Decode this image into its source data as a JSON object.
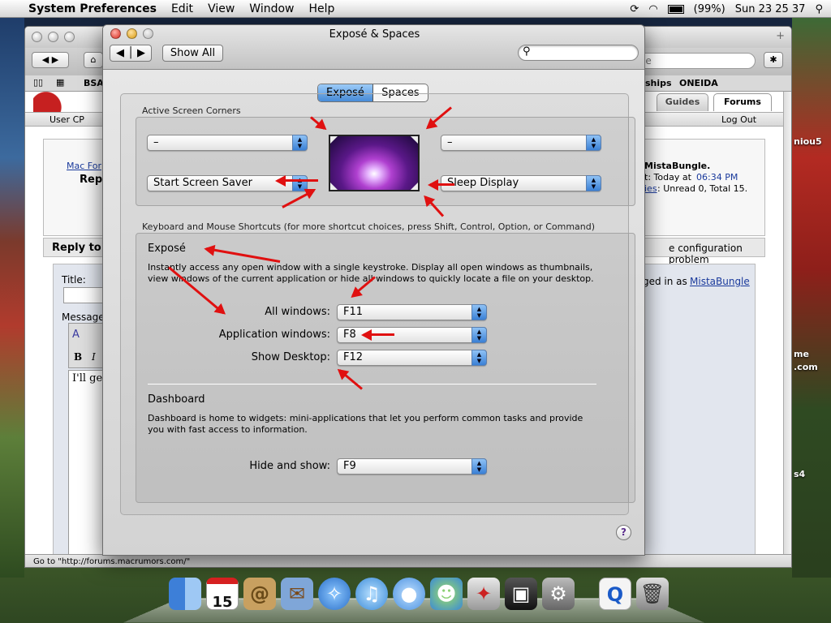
{
  "menubar": {
    "app": "System Preferences",
    "items": [
      "Edit",
      "View",
      "Window",
      "Help"
    ],
    "battery": "(99%)",
    "clock": "Sun 23 25 37"
  },
  "browser": {
    "bookmarks": [
      "BSAA",
      "ships",
      "ONEIDA"
    ],
    "url_tail": "le",
    "tabs": [
      "Guides",
      "Forums"
    ],
    "subnav": {
      "user_cp": "User CP",
      "log_out": "Log Out"
    },
    "breadcrumb": {
      "link": "Mac For",
      "current": "Rep"
    },
    "user_box": {
      "name": "MistaBungle.",
      "last_label": "t: Today at",
      "time": "06:34 PM",
      "pm_link": "ies",
      "pm_counts": ": Unread 0, Total 15."
    },
    "reply_heading": "Reply to",
    "thread_title_tail": "e configuration problem",
    "logged_in_prefix": "ged in as",
    "logged_in_user": "MistaBungle",
    "title_label": "Title:",
    "message_label": "Message:",
    "editor_text": "I'll ge",
    "status_text": "Go to \"http://forums.macrumors.com/\"",
    "right_edge_texts": {
      "user": "niou5",
      "me": "me",
      "com": ".com",
      "s4": "s4"
    }
  },
  "prefs": {
    "title": "Exposé & Spaces",
    "show_all": "Show All",
    "search_placeholder": "",
    "tabs": [
      "Exposé",
      "Spaces"
    ],
    "active_tab": "Exposé",
    "corners_title": "Active Screen Corners",
    "corners": {
      "top_left": "–",
      "top_right": "–",
      "bottom_left": "Start Screen Saver",
      "bottom_right": "Sleep Display"
    },
    "shortcuts_title": "Keyboard and Mouse Shortcuts (for more shortcut choices, press Shift, Control, Option, or Command)",
    "expose": {
      "heading": "Exposé",
      "desc1": "Instantly access any open window with a single keystroke. Display all open windows as thumbnails,",
      "desc2": "view windows of the current application or hide all windows to quickly locate a file on your desktop.",
      "rows": [
        {
          "label": "All windows:",
          "value": "F11"
        },
        {
          "label": "Application windows:",
          "value": "F8"
        },
        {
          "label": "Show Desktop:",
          "value": "F12"
        }
      ]
    },
    "dashboard": {
      "heading": "Dashboard",
      "desc1": "Dashboard is home to widgets: mini-applications that let you perform common tasks and provide",
      "desc2": "you with fast access to information.",
      "row": {
        "label": "Hide and show:",
        "value": "F9"
      }
    },
    "help_label": "?"
  },
  "dock": {
    "items": [
      "finder-icon",
      "ical-icon",
      "address-book-icon",
      "mail-icon",
      "safari-icon",
      "itunes-icon",
      "ichat-icon",
      "users-icon",
      "utility-icon",
      "package-icon",
      "system-preferences-icon",
      "quicktime-file-icon",
      "trash-icon"
    ],
    "ical_date": "15"
  },
  "colors": {
    "accent_blue": "#3a80d6",
    "annotation_red": "#e01010"
  }
}
